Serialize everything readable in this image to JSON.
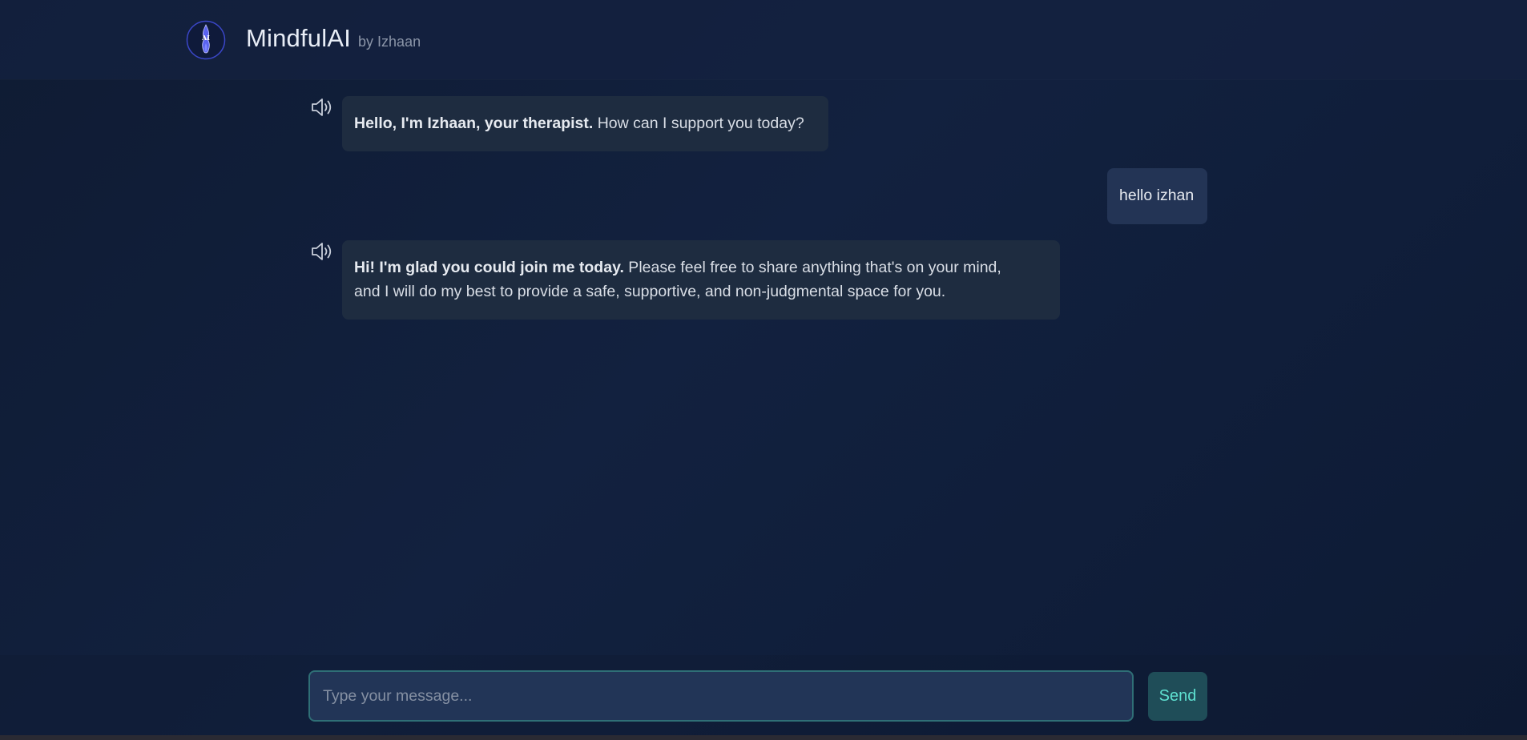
{
  "header": {
    "logo_text": "AI",
    "title": "MindfulAI",
    "subtitle": "by Izhaan"
  },
  "messages": [
    {
      "sender": "bot",
      "bold": "Hello, I'm Izhaan, your therapist.",
      "text": " How can I support you today?",
      "icon": "speaker-icon"
    },
    {
      "sender": "user",
      "text": "hello izhan"
    },
    {
      "sender": "bot",
      "bold": "Hi! I'm glad you could join me today.",
      "text_line1": " Please feel free to share anything that's on your mind,",
      "text_line2": "and I will do my best to provide a safe, supportive, and non-judgmental space for you.",
      "icon": "speaker-icon"
    }
  ],
  "composer": {
    "placeholder": "Type your message...",
    "value": "",
    "send_label": "Send"
  },
  "colors": {
    "background": "#0f1b33",
    "bot_bubble": "#1e2c40",
    "user_bubble": "#233455",
    "accent": "#5ee0d0",
    "input_border": "#2f6f76"
  }
}
